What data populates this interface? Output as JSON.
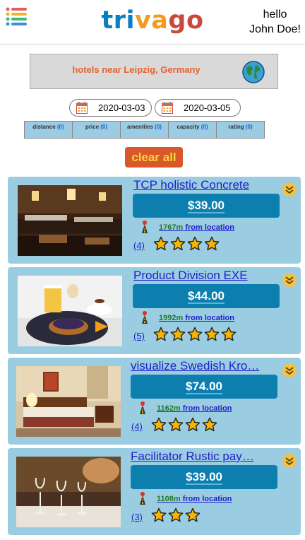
{
  "header": {
    "logo_parts": [
      "tri",
      "va",
      "go"
    ],
    "greeting_line1": "hello",
    "greeting_line2": "John Doe!"
  },
  "search": {
    "query": "hotels near Leipzig, Germany"
  },
  "dates": {
    "checkin": "2020-03-03",
    "checkout": "2020-03-05"
  },
  "filters": [
    {
      "label": "distance",
      "count": "(0)"
    },
    {
      "label": "price",
      "count": "(0)"
    },
    {
      "label": "amenities",
      "count": "(0)"
    },
    {
      "label": "capacity",
      "count": "(0)"
    },
    {
      "label": "rating",
      "count": "(0)"
    }
  ],
  "clear_label": "clear all",
  "hotels": [
    {
      "title": "TCP holistic Concrete",
      "price": "$39.00",
      "distance": "1767m",
      "distance_suffix": "from location",
      "reviews": "(4)",
      "stars": 4,
      "image": "buffet"
    },
    {
      "title": "Product Division EXE",
      "price": "$44.00",
      "distance": "1992m",
      "distance_suffix": "from location",
      "reviews": "(5)",
      "stars": 5,
      "image": "breakfast"
    },
    {
      "title": "visualize Swedish Kro…",
      "price": "$74.00",
      "distance": "1162m",
      "distance_suffix": "from location",
      "reviews": "(4)",
      "stars": 4,
      "image": "bedroom"
    },
    {
      "title": "Facilitator Rustic pay…",
      "price": "$39.00",
      "distance": "1108m",
      "distance_suffix": "from location",
      "reviews": "(3)",
      "stars": 3,
      "image": "glasses"
    }
  ],
  "colors": {
    "card_bg": "#9bcde2",
    "price_bg": "#0d7fae",
    "star": "#f7b500",
    "clear_bg": "#d9582a",
    "clear_text": "#f7d53b"
  },
  "icons": [
    "menu-icon",
    "globe-icon",
    "calendar-icon",
    "chevron-down-icon",
    "road-pin-icon",
    "star-icon"
  ]
}
